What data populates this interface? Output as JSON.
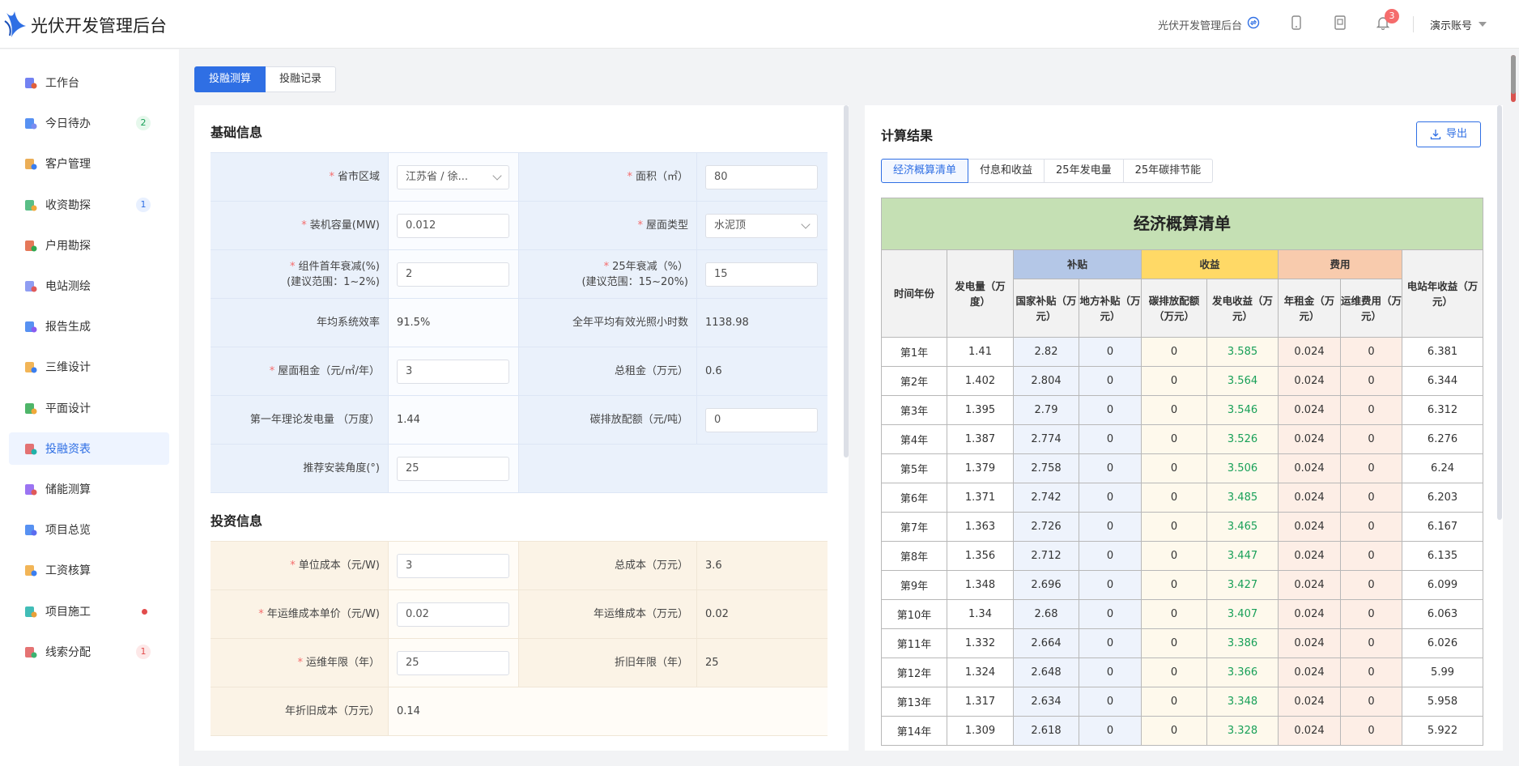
{
  "header": {
    "app_title": "光伏开发管理后台",
    "system_name": "光伏开发管理后台",
    "notification_count": "3",
    "account": "演示账号"
  },
  "sidebar": {
    "items": [
      {
        "label": "工作台",
        "icon": "home-icon"
      },
      {
        "label": "今日待办",
        "icon": "todo-icon",
        "badge": "2"
      },
      {
        "label": "客户管理",
        "icon": "customer-icon"
      },
      {
        "label": "收资勘探",
        "icon": "survey-icon",
        "badge": "1"
      },
      {
        "label": "户用勘探",
        "icon": "household-icon"
      },
      {
        "label": "电站测绘",
        "icon": "mapping-icon"
      },
      {
        "label": "报告生成",
        "icon": "report-icon"
      },
      {
        "label": "三维设计",
        "icon": "3d-design-icon"
      },
      {
        "label": "平面设计",
        "icon": "plan-design-icon"
      },
      {
        "label": "投融资表",
        "icon": "finance-icon"
      },
      {
        "label": "储能测算",
        "icon": "storage-icon"
      },
      {
        "label": "项目总览",
        "icon": "overview-icon"
      },
      {
        "label": "工资核算",
        "icon": "salary-icon"
      },
      {
        "label": "项目施工",
        "icon": "construction-icon"
      },
      {
        "label": "线索分配",
        "icon": "leads-icon",
        "badge": "1"
      }
    ]
  },
  "tabs": [
    "投融测算",
    "投融记录"
  ],
  "basic": {
    "title": "基础信息",
    "region_label": "省市区域",
    "region_value": "江苏省 / 徐...",
    "area_label": "面积（㎡）",
    "area_value": "80",
    "capacity_label": "装机容量(MW)",
    "capacity_value": "0.012",
    "roof_type_label": "屋面类型",
    "roof_type_value": "水泥顶",
    "decay1_label_a": "组件首年衰减(%)",
    "decay1_label_b": "(建议范围：1~2%)",
    "decay1_value": "2",
    "decay25_label_a": "25年衰减（%）",
    "decay25_label_b": "(建议范围：15~20%)",
    "decay25_value": "15",
    "efficiency_label": "年均系统效率",
    "efficiency_value": "91.5%",
    "hours_label": "全年平均有效光照小时数",
    "hours_value": "1138.98",
    "rent_label": "屋面租金（元/㎡/年）",
    "rent_value": "3",
    "total_rent_label": "总租金（万元）",
    "total_rent_value": "0.6",
    "first_power_label": "第一年理论发电量 （万度）",
    "first_power_value": "1.44",
    "carbon_label": "碳排放配额（元/吨）",
    "carbon_value": "0",
    "angle_label": "推荐安装角度(°)",
    "angle_value": "25"
  },
  "invest": {
    "title": "投资信息",
    "unit_cost_label": "单位成本（元/W)",
    "unit_cost_value": "3",
    "total_cost_label": "总成本（万元）",
    "total_cost_value": "3.6",
    "om_price_label": "年运维成本单价（元/W)",
    "om_price_value": "0.02",
    "om_cost_label": "年运维成本（万元）",
    "om_cost_value": "0.02",
    "om_years_label": "运维年限（年）",
    "om_years_value": "25",
    "dep_years_label": "折旧年限（年）",
    "dep_years_value": "25",
    "dep_cost_label": "年折旧成本（万元）",
    "dep_cost_value": "0.14"
  },
  "result": {
    "title": "计算结果",
    "export_label": "导出",
    "tabs": [
      "经济概算清单",
      "付息和收益",
      "25年发电量",
      "25年碳排节能"
    ],
    "table_title": "经济概算清单",
    "headers": {
      "year": "时间年份",
      "power": "发电量（万度）",
      "subsidy": "补贴",
      "income": "收益",
      "fee": "费用",
      "net": "电站年收益（万元）",
      "nat_sub": "国家补贴（万元）",
      "local_sub": "地方补贴（万元）",
      "carbon": "碳排放配额（万元）",
      "power_income": "发电收益（万元）",
      "rent": "年租金（万元）",
      "om": "运维费用（万元）"
    },
    "rows": [
      [
        "第1年",
        "1.41",
        "2.82",
        "0",
        "0",
        "3.585",
        "0.024",
        "0",
        "6.381"
      ],
      [
        "第2年",
        "1.402",
        "2.804",
        "0",
        "0",
        "3.564",
        "0.024",
        "0",
        "6.344"
      ],
      [
        "第3年",
        "1.395",
        "2.79",
        "0",
        "0",
        "3.546",
        "0.024",
        "0",
        "6.312"
      ],
      [
        "第4年",
        "1.387",
        "2.774",
        "0",
        "0",
        "3.526",
        "0.024",
        "0",
        "6.276"
      ],
      [
        "第5年",
        "1.379",
        "2.758",
        "0",
        "0",
        "3.506",
        "0.024",
        "0",
        "6.24"
      ],
      [
        "第6年",
        "1.371",
        "2.742",
        "0",
        "0",
        "3.485",
        "0.024",
        "0",
        "6.203"
      ],
      [
        "第7年",
        "1.363",
        "2.726",
        "0",
        "0",
        "3.465",
        "0.024",
        "0",
        "6.167"
      ],
      [
        "第8年",
        "1.356",
        "2.712",
        "0",
        "0",
        "3.447",
        "0.024",
        "0",
        "6.135"
      ],
      [
        "第9年",
        "1.348",
        "2.696",
        "0",
        "0",
        "3.427",
        "0.024",
        "0",
        "6.099"
      ],
      [
        "第10年",
        "1.34",
        "2.68",
        "0",
        "0",
        "3.407",
        "0.024",
        "0",
        "6.063"
      ],
      [
        "第11年",
        "1.332",
        "2.664",
        "0",
        "0",
        "3.386",
        "0.024",
        "0",
        "6.026"
      ],
      [
        "第12年",
        "1.324",
        "2.648",
        "0",
        "0",
        "3.366",
        "0.024",
        "0",
        "5.99"
      ],
      [
        "第13年",
        "1.317",
        "2.634",
        "0",
        "0",
        "3.348",
        "0.024",
        "0",
        "5.958"
      ],
      [
        "第14年",
        "1.309",
        "2.618",
        "0",
        "0",
        "3.328",
        "0.024",
        "0",
        "5.922"
      ]
    ]
  }
}
